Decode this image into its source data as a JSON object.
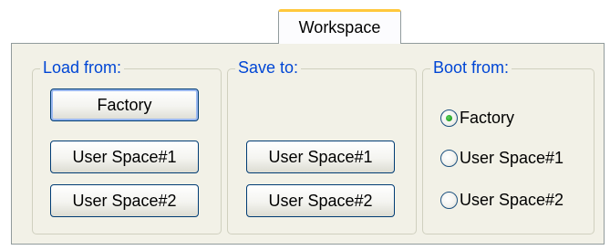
{
  "tab": {
    "label": "Workspace"
  },
  "load_from": {
    "label": "Load from:",
    "buttons": [
      "Factory",
      "User Space#1",
      "User Space#2"
    ]
  },
  "save_to": {
    "label": "Save to:",
    "buttons": [
      "User Space#1",
      "User Space#2"
    ]
  },
  "boot_from": {
    "label": "Boot from:",
    "options": [
      "Factory",
      "User Space#1",
      "User Space#2"
    ],
    "selected": "Factory"
  },
  "colors": {
    "group_label": "#0046d5",
    "panel_background": "#f2f1e7",
    "tab_accent": "#ffc83c",
    "radio_selected": "#21a121"
  }
}
